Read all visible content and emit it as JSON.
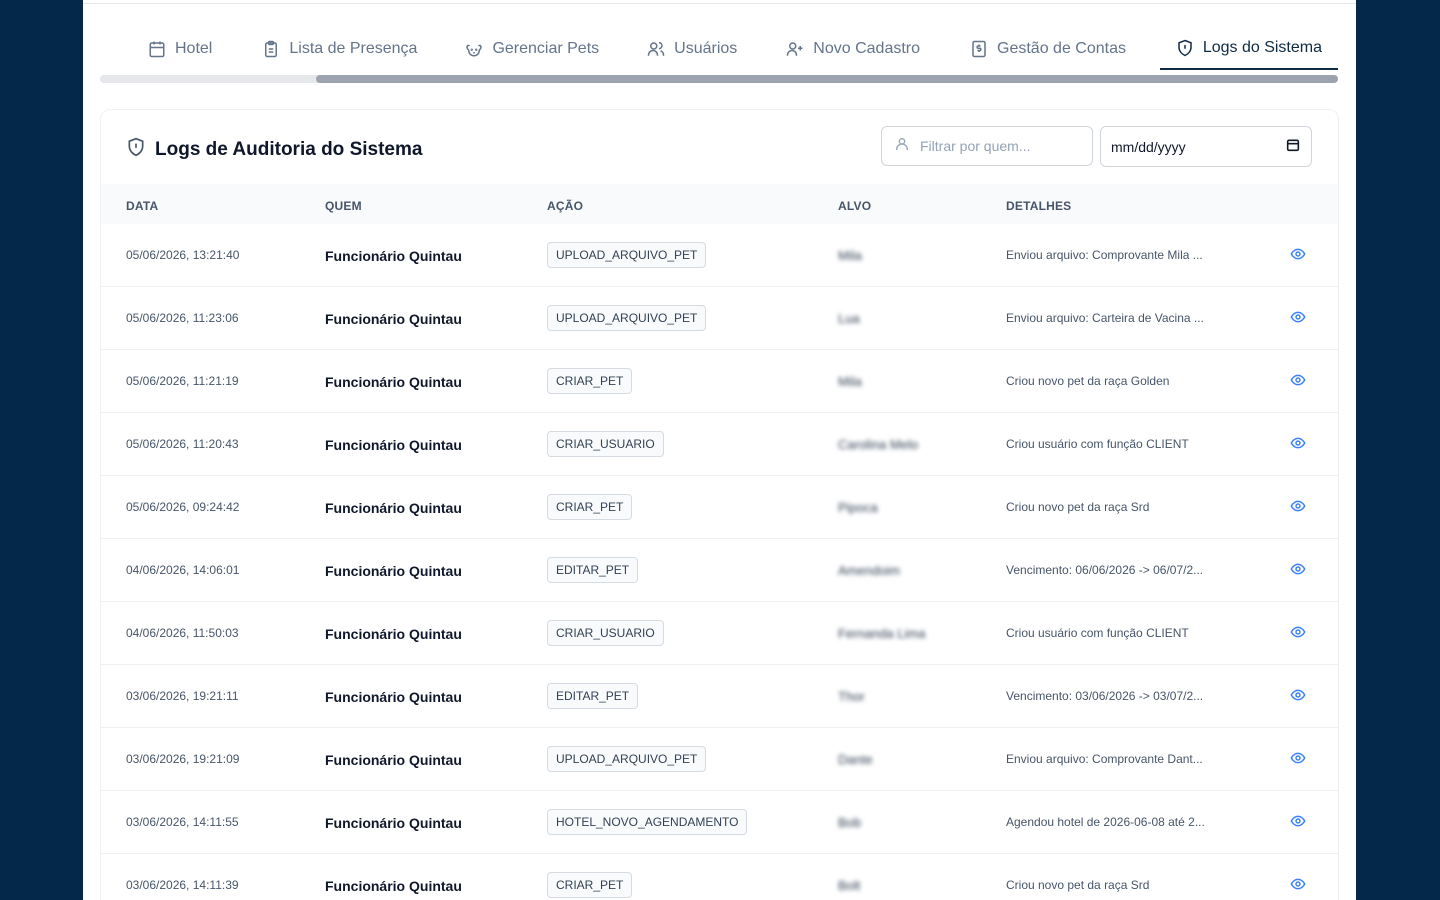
{
  "tabs": [
    {
      "label": "Hotel",
      "icon": "calendar-icon"
    },
    {
      "label": "Lista de Presença",
      "icon": "clipboard-icon"
    },
    {
      "label": "Gerenciar Pets",
      "icon": "pet-icon"
    },
    {
      "label": "Usuários",
      "icon": "users-icon"
    },
    {
      "label": "Novo Cadastro",
      "icon": "user-plus-icon"
    },
    {
      "label": "Gestão de Contas",
      "icon": "receipt-icon"
    },
    {
      "label": "Logs do Sistema",
      "icon": "shield-icon",
      "active": true
    }
  ],
  "card": {
    "title": "Logs de Auditoria do Sistema",
    "filter_placeholder": "Filtrar por quem...",
    "date_placeholder": "mm/dd/yyyy"
  },
  "table": {
    "headers": {
      "date": "DATA",
      "who": "QUEM",
      "action": "AÇÃO",
      "target": "ALVO",
      "details": "DETALHES"
    },
    "rows": [
      {
        "date": "05/06/2026, 13:21:40",
        "who": "Funcionário Quintau",
        "action": "UPLOAD_ARQUIVO_PET",
        "target": "Mila",
        "details": "Enviou arquivo: Comprovante Mila ..."
      },
      {
        "date": "05/06/2026, 11:23:06",
        "who": "Funcionário Quintau",
        "action": "UPLOAD_ARQUIVO_PET",
        "target": "Lua",
        "details": "Enviou arquivo: Carteira de Vacina ..."
      },
      {
        "date": "05/06/2026, 11:21:19",
        "who": "Funcionário Quintau",
        "action": "CRIAR_PET",
        "target": "Mila",
        "details": "Criou novo pet da raça Golden"
      },
      {
        "date": "05/06/2026, 11:20:43",
        "who": "Funcionário Quintau",
        "action": "CRIAR_USUARIO",
        "target": "Carolina Melo",
        "details": "Criou usuário com função CLIENT"
      },
      {
        "date": "05/06/2026, 09:24:42",
        "who": "Funcionário Quintau",
        "action": "CRIAR_PET",
        "target": "Pipoca",
        "details": "Criou novo pet da raça Srd"
      },
      {
        "date": "04/06/2026, 14:06:01",
        "who": "Funcionário Quintau",
        "action": "EDITAR_PET",
        "target": "Amendoim",
        "details": "Vencimento: 06/06/2026 -> 06/07/2..."
      },
      {
        "date": "04/06/2026, 11:50:03",
        "who": "Funcionário Quintau",
        "action": "CRIAR_USUARIO",
        "target": "Fernanda Lima",
        "details": "Criou usuário com função CLIENT"
      },
      {
        "date": "03/06/2026, 19:21:11",
        "who": "Funcionário Quintau",
        "action": "EDITAR_PET",
        "target": "Thor",
        "details": "Vencimento: 03/06/2026 -> 03/07/2..."
      },
      {
        "date": "03/06/2026, 19:21:09",
        "who": "Funcionário Quintau",
        "action": "UPLOAD_ARQUIVO_PET",
        "target": "Dante",
        "details": "Enviou arquivo: Comprovante Dant..."
      },
      {
        "date": "03/06/2026, 14:11:55",
        "who": "Funcionário Quintau",
        "action": "HOTEL_NOVO_AGENDAMENTO",
        "target": "Bob",
        "details": "Agendou hotel de 2026-06-08 até 2..."
      },
      {
        "date": "03/06/2026, 14:11:39",
        "who": "Funcionário Quintau",
        "action": "CRIAR_PET",
        "target": "Bolt",
        "details": "Criou novo pet da raça Srd"
      }
    ]
  },
  "colors": {
    "accent": "#0f2a44",
    "link": "#3b82f6",
    "backdrop": "#03284a"
  }
}
